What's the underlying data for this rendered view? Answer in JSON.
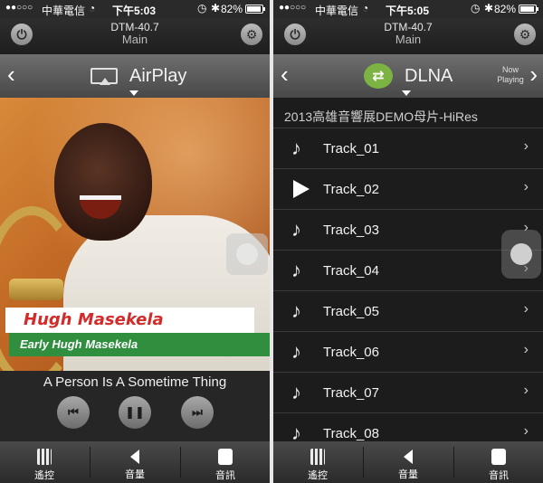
{
  "left": {
    "status": {
      "signal": "●●○○○",
      "carrier": "中華電信",
      "time": "下午5:03",
      "battery": "82%"
    },
    "header": {
      "device": "DTM-40.7",
      "zone": "Main"
    },
    "source": {
      "name": "AirPlay"
    },
    "album_art": {
      "artist_caption": "Hugh Masekela",
      "album_caption": "Early Hugh Masekela"
    },
    "player": {
      "song": "A Person Is A Sometime Thing"
    },
    "tabs": [
      {
        "label": "遙控",
        "icon": "keypad-icon"
      },
      {
        "label": "音量",
        "icon": "speaker-icon"
      },
      {
        "label": "音訊",
        "icon": "equalizer-icon"
      }
    ]
  },
  "right": {
    "status": {
      "signal": "●●○○○",
      "carrier": "中華電信",
      "time": "下午5:05",
      "battery": "82%"
    },
    "header": {
      "device": "DTM-40.7",
      "zone": "Main"
    },
    "source": {
      "name": "DLNA",
      "now_playing": "Now Playing"
    },
    "playlist": {
      "title": "2013高雄音響展DEMO母片-HiRes",
      "tracks": [
        {
          "name": "Track_01",
          "playing": false
        },
        {
          "name": "Track_02",
          "playing": true
        },
        {
          "name": "Track_03",
          "playing": false
        },
        {
          "name": "Track_04",
          "playing": false
        },
        {
          "name": "Track_05",
          "playing": false
        },
        {
          "name": "Track_06",
          "playing": false
        },
        {
          "name": "Track_07",
          "playing": false
        },
        {
          "name": "Track_08",
          "playing": false
        }
      ]
    },
    "tabs": [
      {
        "label": "遙控",
        "icon": "keypad-icon"
      },
      {
        "label": "音量",
        "icon": "speaker-icon"
      },
      {
        "label": "音訊",
        "icon": "equalizer-icon"
      }
    ]
  },
  "colors": {
    "artist_red": "#d32a2a",
    "album_green": "#2f8f3f",
    "dlna_green": "#7cb342"
  }
}
